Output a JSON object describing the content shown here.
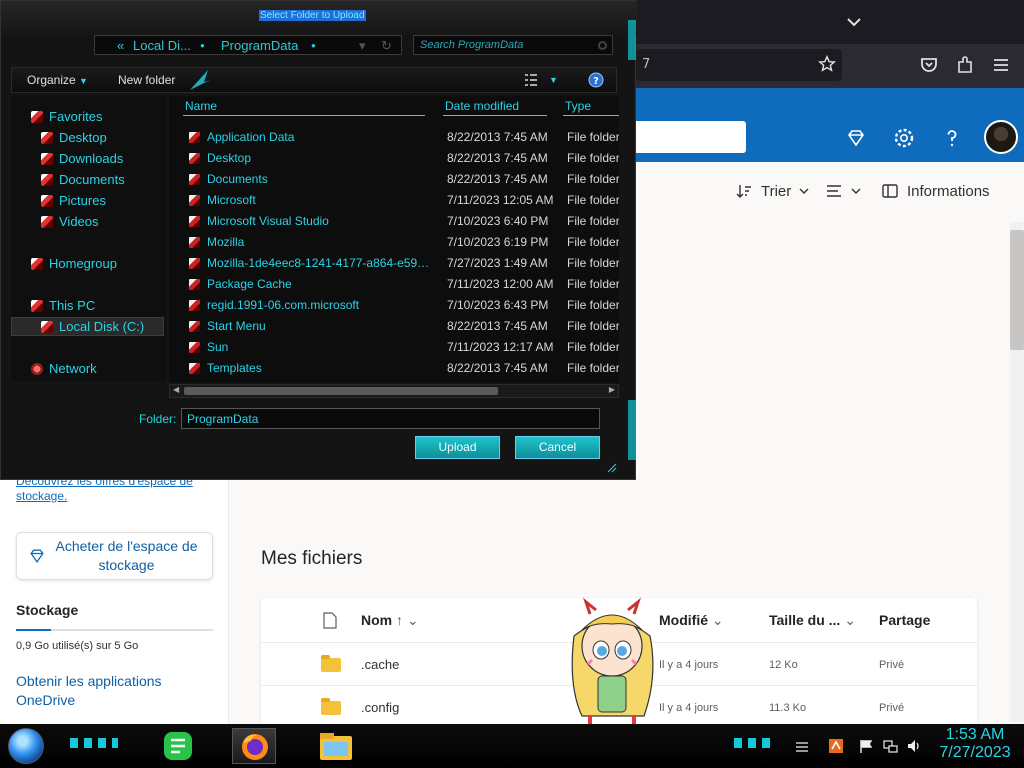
{
  "dialog": {
    "title": "Select Folder to Upload",
    "address": {
      "back": "«",
      "crumb1": "Local Di...",
      "crumb2": "ProgramData"
    },
    "search_placeholder": "Search ProgramData",
    "toolbar": {
      "organize": "Organize",
      "new_folder": "New folder"
    },
    "nav": [
      {
        "label": "Favorites"
      },
      {
        "label": "Desktop"
      },
      {
        "label": "Downloads"
      },
      {
        "label": "Documents"
      },
      {
        "label": "Pictures"
      },
      {
        "label": "Videos"
      },
      {
        "label": "Homegroup"
      },
      {
        "label": "This PC"
      },
      {
        "label": "Local Disk (C:)"
      },
      {
        "label": "Network"
      }
    ],
    "columns": {
      "name": "Name",
      "date": "Date modified",
      "type": "Type"
    },
    "rows": [
      {
        "name": "Application Data",
        "date": "8/22/2013 7:45 AM",
        "type": "File folder"
      },
      {
        "name": "Desktop",
        "date": "8/22/2013 7:45 AM",
        "type": "File folder"
      },
      {
        "name": "Documents",
        "date": "8/22/2013 7:45 AM",
        "type": "File folder"
      },
      {
        "name": "Microsoft",
        "date": "7/11/2023 12:05 AM",
        "type": "File folder"
      },
      {
        "name": "Microsoft Visual Studio",
        "date": "7/10/2023 6:40 PM",
        "type": "File folder"
      },
      {
        "name": "Mozilla",
        "date": "7/10/2023 6:19 PM",
        "type": "File folder"
      },
      {
        "name": "Mozilla-1de4eec8-1241-4177-a864-e594e8d...",
        "date": "7/27/2023 1:49 AM",
        "type": "File folder"
      },
      {
        "name": "Package Cache",
        "date": "7/11/2023 12:00 AM",
        "type": "File folder"
      },
      {
        "name": "regid.1991-06.com.microsoft",
        "date": "7/10/2023 6:43 PM",
        "type": "File folder"
      },
      {
        "name": "Start Menu",
        "date": "8/22/2013 7:45 AM",
        "type": "File folder"
      },
      {
        "name": "Sun",
        "date": "7/11/2023 12:17 AM",
        "type": "File folder"
      },
      {
        "name": "Templates",
        "date": "8/22/2013 7:45 AM",
        "type": "File folder"
      }
    ],
    "folder_label": "Folder:",
    "folder_value": "ProgramData",
    "upload": "Upload",
    "cancel": "Cancel"
  },
  "firefox": {
    "url_fragment": "7"
  },
  "onedrive": {
    "cmd": {
      "sort": "Trier",
      "info": "Informations"
    },
    "discover": "Découvrez les offres d'espace de stockage.",
    "buy": "Acheter de l'espace de stockage",
    "storage_title": "Stockage",
    "storage_used": "0,9 Go utilisé(s) sur 5 Go",
    "storage_fraction": 0.18,
    "get_apps": "Obtenir les applications OneDrive",
    "files_title": "Mes fichiers",
    "columns": {
      "name": "Nom",
      "sort_arrow": "↑",
      "modified": "Modifié",
      "size": "Taille du ...",
      "sharing": "Partage"
    },
    "rows": [
      {
        "name": ".cache",
        "modified": "Il y a 4 jours",
        "size": "12 Ko",
        "sharing": "Privé"
      },
      {
        "name": ".config",
        "modified": "Il y a 4 jours",
        "size": "11.3 Ko",
        "sharing": "Privé"
      }
    ]
  },
  "taskbar": {
    "time": "1:53 AM",
    "date": "7/27/2023"
  },
  "colors": {
    "accent": "#2bd3e6",
    "onedrive_blue": "#0f6cbd"
  }
}
